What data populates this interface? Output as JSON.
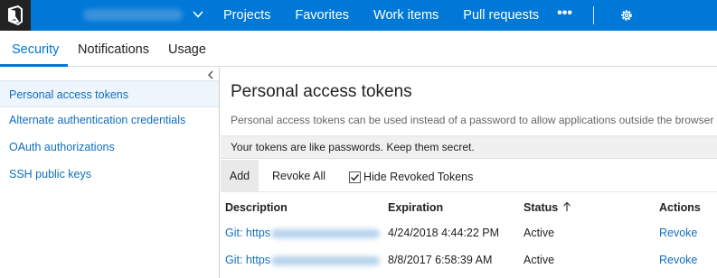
{
  "topbar": {
    "nav": [
      "Projects",
      "Favorites",
      "Work items",
      "Pull requests"
    ],
    "more_label": "•••",
    "colors": {
      "bar": "#0078d7",
      "logo_bg": "#222222"
    }
  },
  "tabs": [
    {
      "label": "Security",
      "active": true
    },
    {
      "label": "Notifications",
      "active": false
    },
    {
      "label": "Usage",
      "active": false
    }
  ],
  "sidebar": {
    "items": [
      {
        "label": "Personal access tokens",
        "selected": true
      },
      {
        "label": "Alternate authentication credentials",
        "selected": false
      },
      {
        "label": "OAuth authorizations",
        "selected": false
      },
      {
        "label": "SSH public keys",
        "selected": false
      }
    ]
  },
  "main": {
    "title": "Personal access tokens",
    "description": "Personal access tokens can be used instead of a password to allow applications outside the browser ac",
    "notice": "Your tokens are like passwords. Keep them secret.",
    "toolbar": {
      "add_label": "Add",
      "revoke_all_label": "Revoke All",
      "hide_revoked_label": "Hide Revoked Tokens",
      "hide_revoked_checked": true
    },
    "table": {
      "columns": [
        "Description",
        "Expiration",
        "Status",
        "Actions"
      ],
      "sort_column": "Status",
      "sort_direction": "ascending",
      "rows": [
        {
          "description": "Git: https",
          "expiration": "4/24/2018 4:44:22 PM",
          "status": "Active",
          "action": "Revoke"
        },
        {
          "description": "Git: https",
          "expiration": "8/8/2017 6:58:39 AM",
          "status": "Active",
          "action": "Revoke"
        }
      ]
    }
  }
}
